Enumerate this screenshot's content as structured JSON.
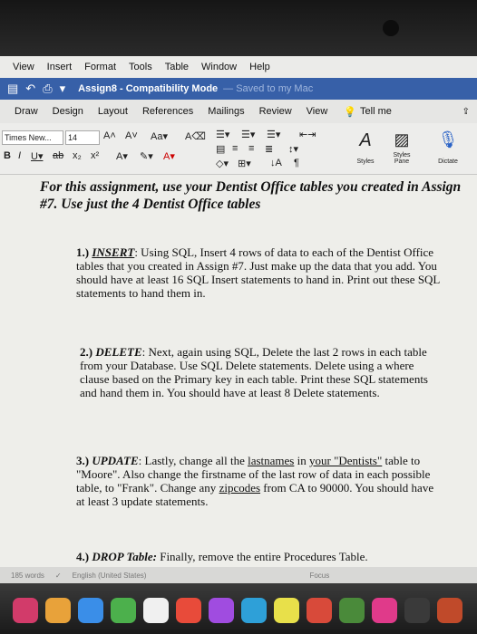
{
  "menubar": {
    "items": [
      "View",
      "Insert",
      "Format",
      "Tools",
      "Table",
      "Window",
      "Help"
    ]
  },
  "titlebar": {
    "document": "Assign8 - Compatibility Mode",
    "saved": "— Saved to my Mac"
  },
  "ribbon_tabs": {
    "items": [
      "Draw",
      "Design",
      "Layout",
      "References",
      "Mailings",
      "Review",
      "View"
    ],
    "tell_me": "Tell me"
  },
  "ribbon": {
    "font_name": "Times New...",
    "font_size": "14",
    "styles_label": "Styles",
    "styles_pane_label": "Styles Pane",
    "dictate_label": "Dictate"
  },
  "document": {
    "intro": "For this assignment, use your Dentist Office tables you created in Assign #7.  Use just the 4 Dentist Office tables",
    "item1": {
      "num": "1.)",
      "keyword": "INSERT",
      "text": ":  Using SQL, Insert 4 rows of data to each of the Dentist Office tables that you created in Assign #7.  Just make up the data that you add.  You should have at least 16 SQL Insert statements to hand in.  Print out these SQL statements to hand them in."
    },
    "item2": {
      "num": "2.)",
      "keyword": "DELETE",
      "text": ":  Next, again using SQL, Delete the last 2 rows in each table from your Database.  Use SQL Delete statements.  Delete using a where clause based on the Primary key in each table.  Print these SQL statements and hand them in.  You should have at least 8 Delete statements."
    },
    "item3": {
      "num": "3.)",
      "keyword": "UPDATE",
      "text_a": ":  Lastly, change all the ",
      "u1": "lastnames",
      "text_b": " in ",
      "u2": "your  \"Dentists\"",
      "text_c": " table to \"Moore\".  Also change the firstname of the last row of data in each possible table, to \"Frank\".  Change any ",
      "u3": "zipcodes",
      "text_d": " from CA to 90000.  You should have at least 3 update statements."
    },
    "item4": {
      "num": "4.)",
      "keyword": "DROP Table:",
      "text": "  Finally, remove the entire Procedures Table."
    }
  },
  "statusbar": {
    "words": "185 words",
    "language": "English (United States)",
    "focus": "Focus"
  }
}
